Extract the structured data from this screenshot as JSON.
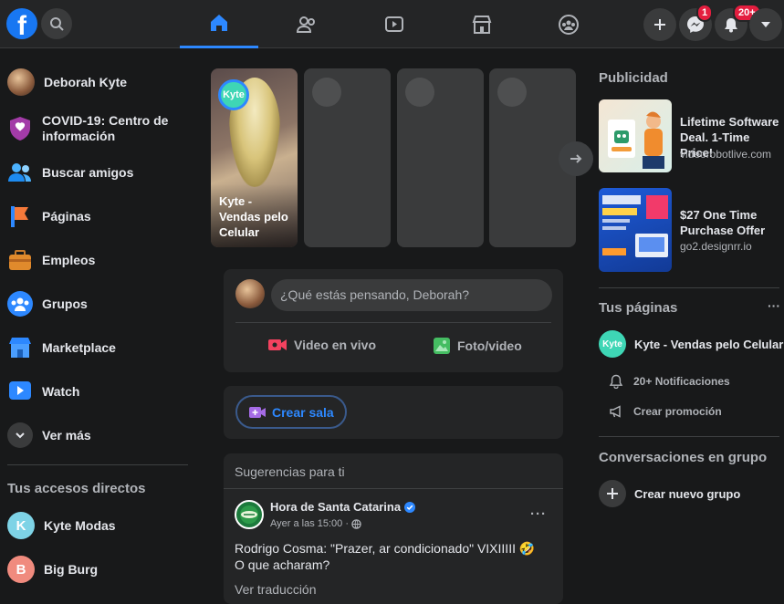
{
  "topbar": {
    "logo": "f",
    "messenger_badge": "1",
    "notifications_badge": "20+"
  },
  "left_nav": {
    "user_name": "Deborah Kyte",
    "items": [
      {
        "label": "COVID-19: Centro de información"
      },
      {
        "label": "Buscar amigos"
      },
      {
        "label": "Páginas"
      },
      {
        "label": "Empleos"
      },
      {
        "label": "Grupos"
      },
      {
        "label": "Marketplace"
      },
      {
        "label": "Watch"
      },
      {
        "label": "Ver más"
      }
    ],
    "shortcuts_title": "Tus accesos directos",
    "shortcuts": [
      {
        "letter": "K",
        "label": "Kyte Modas",
        "color": "#7ed3e6"
      },
      {
        "letter": "B",
        "label": "Big Burg",
        "color": "#f08b7e"
      }
    ]
  },
  "stories": {
    "first": {
      "badge": "Kyte",
      "caption": "Kyte - Vendas pelo Celular"
    }
  },
  "composer": {
    "placeholder": "¿Qué estás pensando, Deborah?",
    "live_video": "Video en vivo",
    "photo_video": "Foto/video"
  },
  "room": {
    "label": "Crear sala"
  },
  "suggestion": {
    "header": "Sugerencias para ti",
    "page_name": "Hora de Santa Catarina",
    "time": "Ayer a las 15:00 ·",
    "text": "Rodrigo Cosma: \"Prazer, ar condicionado\" VIXIIIII 🤣 O que acharam?",
    "translate": "Ver traducción"
  },
  "ads": {
    "title": "Publicidad",
    "items": [
      {
        "headline": "Lifetime Software Deal. 1-Time Price!",
        "domain": "videorobotlive.com"
      },
      {
        "headline": "$27 One Time Purchase Offer",
        "domain": "go2.designrr.io"
      }
    ]
  },
  "pages": {
    "title": "Tus páginas",
    "more": "···",
    "page_badge": "Kyte",
    "page_name": "Kyte - Vendas pelo Celular",
    "notifications": "20+ Notificaciones",
    "promo": "Crear promoción"
  },
  "groups": {
    "title": "Conversaciones en grupo",
    "create": "Crear nuevo grupo"
  }
}
